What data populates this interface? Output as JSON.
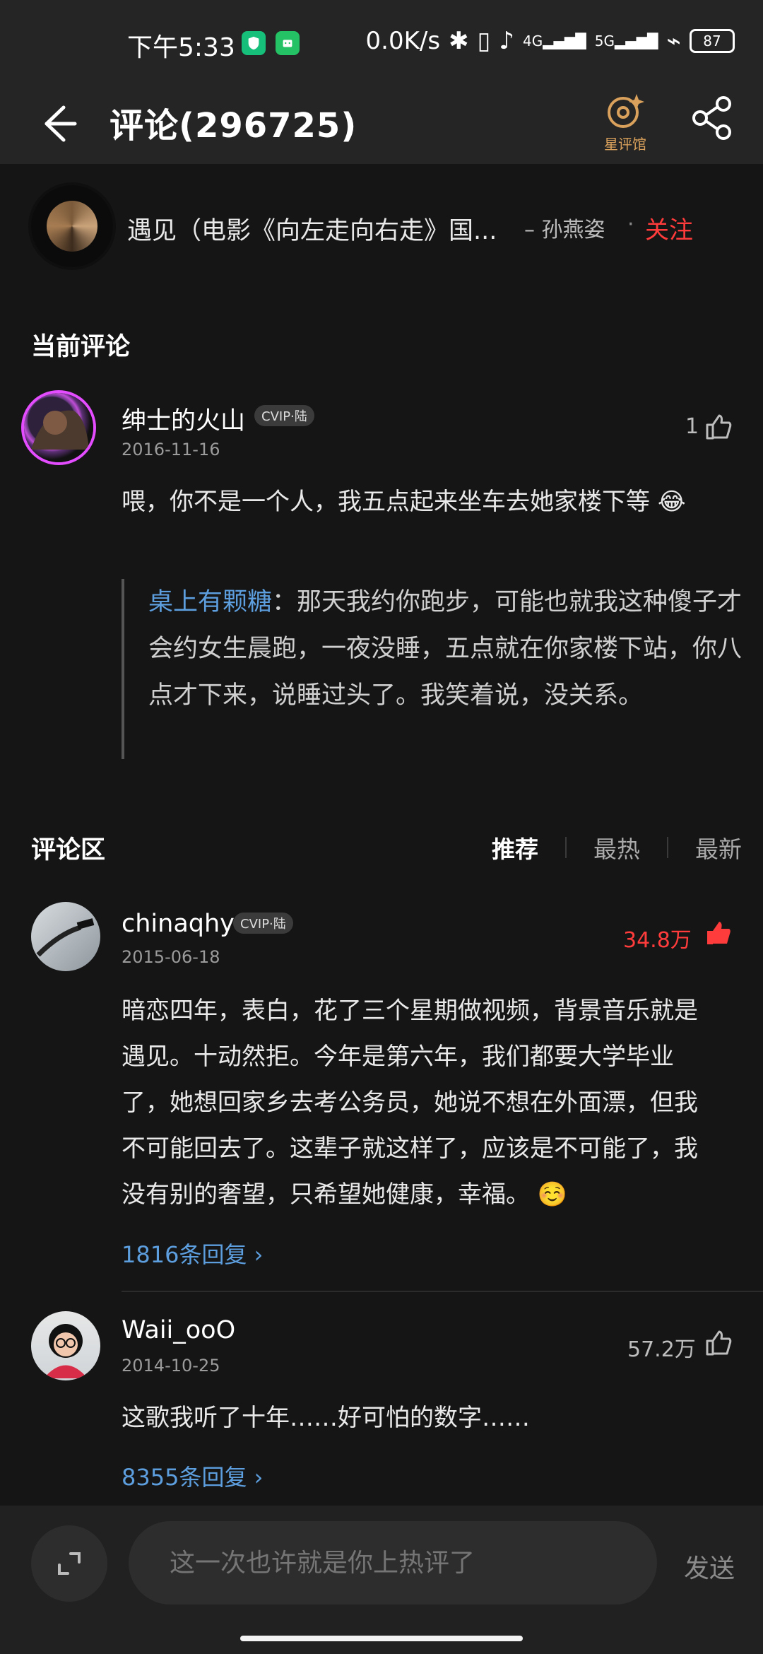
{
  "status_bar": {
    "time": "下午5:33",
    "network_speed": "0.0K/s",
    "network_4g": "4G",
    "network_5g": "5G",
    "battery": "87"
  },
  "header": {
    "title": "评论(296725)",
    "star_label": "星评馆"
  },
  "song": {
    "title": "遇见（电影《向左走向右走》国...",
    "artist": "– 孙燕姿",
    "separator": "·",
    "follow": "关注"
  },
  "current_comment": {
    "section_title": "当前评论",
    "user": "绅士的火山",
    "badge": "CVIP·陆",
    "date": "2016-11-16",
    "likes": "1",
    "text": "喂，你不是一个人，我五点起来坐车去她家楼下等",
    "emoji": "😂",
    "reply_name": "桌上有颗糖",
    "reply_separator": "：",
    "reply_text": "那天我约你跑步，可能也就我这种傻子才会约女生晨跑，一夜没睡，五点就在你家楼下站，你八点才下来，说睡过头了。我笑着说，没关系。"
  },
  "comments_section": {
    "title": "评论区",
    "tabs": [
      "推荐",
      "最热",
      "最新"
    ],
    "items": [
      {
        "user": "chinaqhy",
        "badge": "CVIP·陆",
        "date": "2015-06-18",
        "likes": "34.8万",
        "text": "暗恋四年，表白，花了三个星期做视频，背景音乐就是遇见。十动然拒。今年是第六年，我们都要大学毕业了，她想回家乡去考公务员，她说不想在外面漂，但我不可能回去了。这辈子就这样了，应该是不可能了，我没有别的奢望，只希望她健康，幸福。",
        "emoji": "☺️",
        "replies": "1816条回复 ›"
      },
      {
        "user": "Waii_ooO",
        "date": "2014-10-25",
        "likes": "57.2万",
        "text": "这歌我听了十年……好可怕的数字……",
        "replies": "8355条回复 ›"
      }
    ]
  },
  "composer": {
    "placeholder": "这一次也许就是你上热评了",
    "send": "发送"
  }
}
